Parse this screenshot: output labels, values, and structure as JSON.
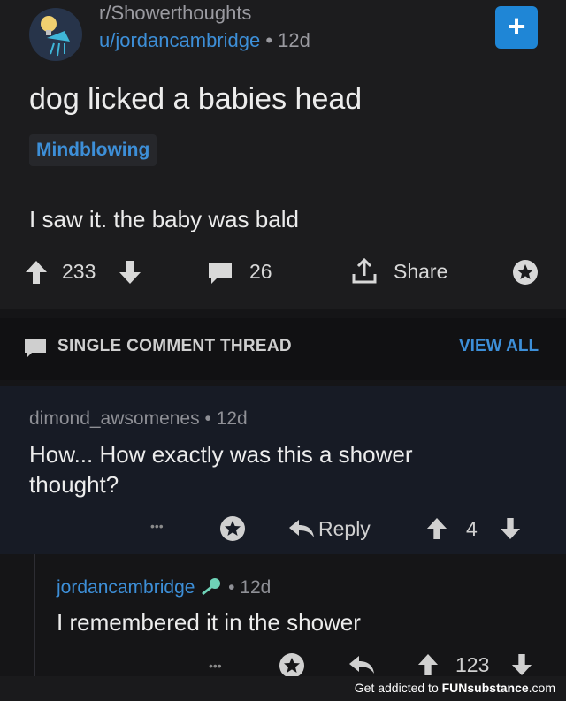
{
  "post": {
    "subreddit": "r/Showerthoughts",
    "author": "u/jordancambridge",
    "age": "• 12d",
    "join_label": "+",
    "title": "dog licked a babies head",
    "flair": "Mindblowing",
    "body": "I saw it. the baby was bald",
    "upvotes": "233",
    "comments": "26",
    "share_label": "Share"
  },
  "thread": {
    "label": "SINGLE COMMENT THREAD",
    "view_all": "VIEW ALL"
  },
  "comment1": {
    "author": "dimond_awsomenes",
    "age": "• 12d",
    "text_line1": "How... How exactly was this a shower",
    "text_line2": "thought?",
    "more": "•••",
    "reply_label": "Reply",
    "score": "4"
  },
  "comment2": {
    "author": "jordancambridge",
    "age": "• 12d",
    "text": "I remembered it in the shower",
    "more": "•••",
    "score": "123"
  },
  "footer": {
    "prefix": "Get addicted to ",
    "brand": "FUNsubstance",
    "suffix": ".com"
  },
  "colors": {
    "accent": "#3d8fd8",
    "background": "#1c1c1e",
    "highlight_comment": "#171b25"
  }
}
